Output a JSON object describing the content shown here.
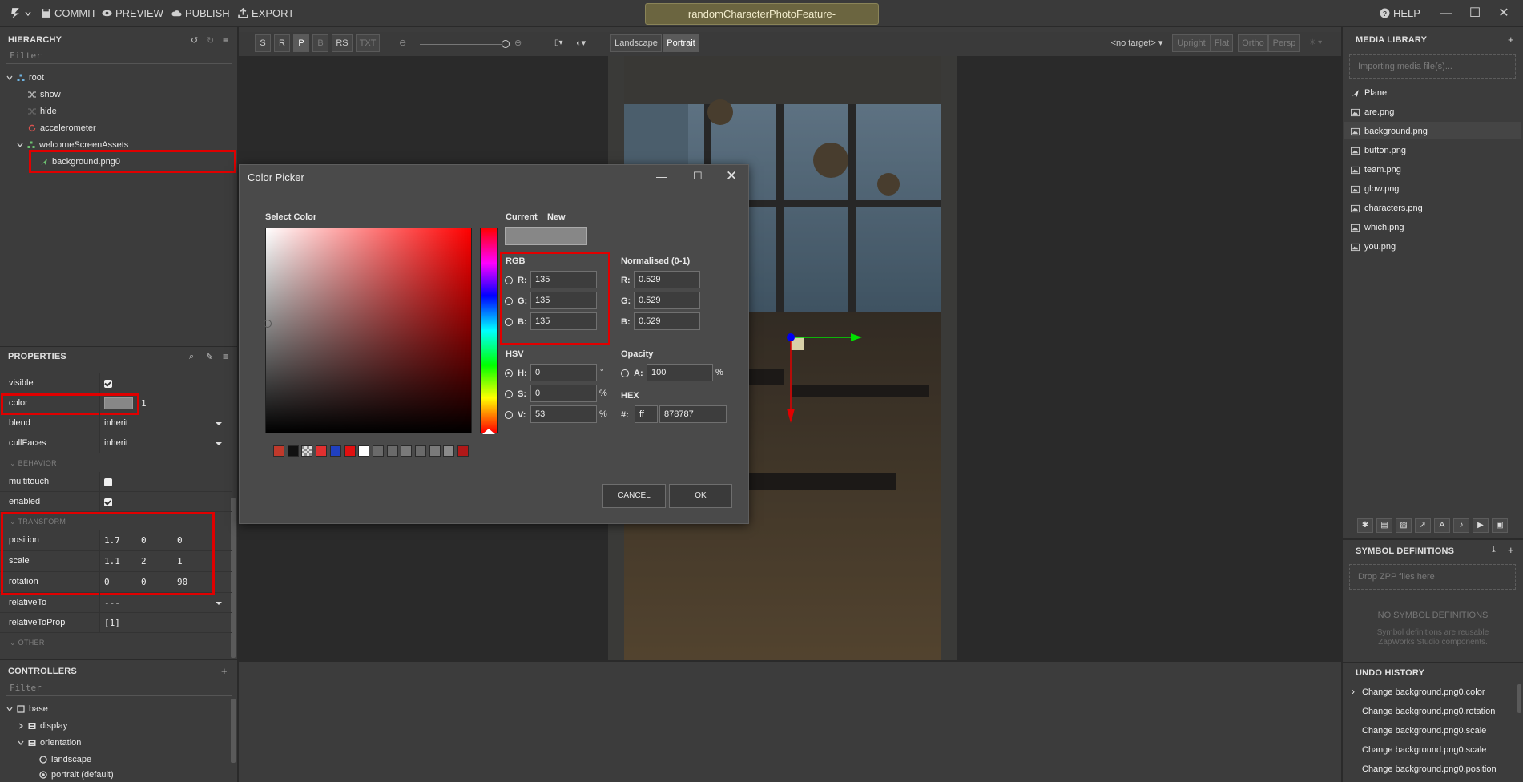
{
  "topbar": {
    "commit": "COMMIT",
    "preview": "PREVIEW",
    "publish": "PUBLISH",
    "export": "EXPORT",
    "title": "randomCharacterPhotoFeature-",
    "help": "HELP",
    "minimize": "—",
    "maximize": "☐",
    "close": "✕"
  },
  "hierarchy": {
    "title": "HIERARCHY",
    "filter_placeholder": "Filter",
    "items": [
      {
        "label": "root",
        "icon": "group-icon"
      },
      {
        "label": "show",
        "icon": "shuffle-icon"
      },
      {
        "label": "hide",
        "icon": "shuffle-icon"
      },
      {
        "label": "accelerometer",
        "icon": "refresh-icon"
      },
      {
        "label": "welcomeScreenAssets",
        "icon": "group-icon"
      },
      {
        "label": "background.png0",
        "icon": "plane-icon"
      }
    ]
  },
  "properties": {
    "title": "PROPERTIES",
    "visible_label": "visible",
    "color_label": "color",
    "color_alpha": "1",
    "blend_label": "blend",
    "blend_value": "inherit",
    "cullfaces_label": "cullFaces",
    "cullfaces_value": "inherit",
    "behavior_section": "BEHAVIOR",
    "multitouch_label": "multitouch",
    "enabled_label": "enabled",
    "transform_section": "TRANSFORM",
    "position_label": "position",
    "position": [
      "1.7",
      "0",
      "0"
    ],
    "scale_label": "scale",
    "scale": [
      "1.1",
      "2",
      "1"
    ],
    "rotation_label": "rotation",
    "rotation": [
      "0",
      "0",
      "90"
    ],
    "relativeto_label": "relativeTo",
    "relativeto_value": "---",
    "relativetoprop_label": "relativeToProp",
    "relativetoprop_value": "[1]",
    "other_section": "OTHER"
  },
  "controllers": {
    "title": "CONTROLLERS",
    "filter_placeholder": "Filter",
    "items": [
      {
        "label": "base"
      },
      {
        "label": "display"
      },
      {
        "label": "orientation"
      },
      {
        "label": "landscape"
      },
      {
        "label": "portrait (default)"
      }
    ]
  },
  "viewport_toolbar": {
    "modes": [
      "S",
      "R",
      "P",
      "B",
      "RS",
      "TXT"
    ],
    "landscape": "Landscape",
    "portrait": "Portrait",
    "target": "<no target>",
    "upright": "Upright",
    "flat": "Flat",
    "ortho": "Ortho",
    "persp": "Persp"
  },
  "color_picker": {
    "title": "Color Picker",
    "select_color": "Select Color",
    "current": "Current",
    "new": "New",
    "rgb_label": "RGB",
    "r_label": "R:",
    "g_label": "G:",
    "b_label": "B:",
    "r": "135",
    "g": "135",
    "b": "135",
    "normalised_label": "Normalised (0-1)",
    "nr": "0.529",
    "ng": "0.529",
    "nb": "0.529",
    "hsv_label": "HSV",
    "h_label": "H:",
    "s_label": "S:",
    "v_label": "V:",
    "h": "0",
    "s": "0",
    "v": "53",
    "degree": "°",
    "percent": "%",
    "opacity_label": "Opacity",
    "a_label": "A:",
    "a": "100",
    "hex_label": "HEX",
    "hash_label": "#:",
    "hex_alpha": "ff",
    "hex": "878787",
    "cancel": "CANCEL",
    "ok": "OK",
    "current_color": "#878787",
    "swatches": [
      "#c0392b",
      "#111111",
      "checker",
      "#e03030",
      "#2040c0",
      "#e01010",
      "#ffffff",
      "#6a6a6a",
      "#6a6a6a",
      "#7a7a7a",
      "#6a6a6a",
      "#7a7a7a",
      "#8a8a8a",
      "#b01818"
    ]
  },
  "media_library": {
    "title": "MEDIA LIBRARY",
    "importing": "Importing media file(s)...",
    "items": [
      {
        "label": "Plane",
        "icon": "plane-icon"
      },
      {
        "label": "are.png",
        "icon": "image-icon"
      },
      {
        "label": "background.png",
        "icon": "image-icon"
      },
      {
        "label": "button.png",
        "icon": "image-icon"
      },
      {
        "label": "team.png",
        "icon": "image-icon"
      },
      {
        "label": "glow.png",
        "icon": "image-icon"
      },
      {
        "label": "characters.png",
        "icon": "image-icon"
      },
      {
        "label": "which.png",
        "icon": "image-icon"
      },
      {
        "label": "you.png",
        "icon": "image-icon"
      }
    ]
  },
  "symbol_definitions": {
    "title": "SYMBOL DEFINITIONS",
    "drop": "Drop ZPP files here",
    "none": "NO SYMBOL DEFINITIONS",
    "desc1": "Symbol definitions are reusable",
    "desc2": "ZapWorks Studio components."
  },
  "undo_history": {
    "title": "UNDO HISTORY",
    "items": [
      "Change background.png0.color",
      "Change background.png0.rotation",
      "Change background.png0.scale",
      "Change background.png0.scale",
      "Change background.png0.position"
    ]
  }
}
